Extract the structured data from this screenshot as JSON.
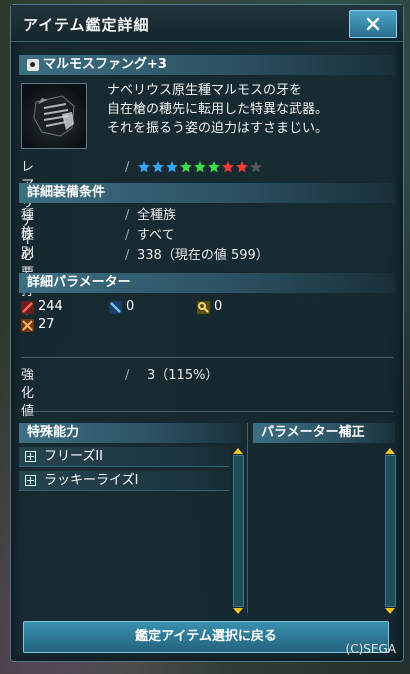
{
  "window": {
    "title": "アイテム鑑定詳細",
    "close_icon": "close-icon"
  },
  "item": {
    "name": "マルモスファング+3",
    "description": [
      "ナベリウス原生種マルモスの牙を",
      "自在槍の穂先に転用した特異な武器。",
      "それを振るう姿の迫力はすさまじい。"
    ]
  },
  "rarity": {
    "label": "レアリティ",
    "value": 8,
    "max": 9,
    "star_colors": [
      "#36a6ff",
      "#36a6ff",
      "#36a6ff",
      "#3ddc4a",
      "#3ddc4a",
      "#3ddc4a",
      "#ff3b3b",
      "#ff3b3b",
      "#555555"
    ]
  },
  "requirements": {
    "header": "詳細装備条件",
    "rows": [
      {
        "label": "種族",
        "value": "全種族"
      },
      {
        "label": "性別",
        "value": "すべて"
      },
      {
        "label": "必要打撃力",
        "value": "338（現在の値 599）"
      }
    ]
  },
  "parameters": {
    "header": "詳細パラメーター",
    "items": [
      {
        "icon": "striking-attack-icon",
        "value": "244",
        "color": "#d8463c"
      },
      {
        "icon": "ranged-attack-icon",
        "value": "0",
        "color": "#3e8fd6"
      },
      {
        "icon": "technique-attack-icon",
        "value": "0",
        "color": "#e0c040"
      },
      {
        "icon": "element-icon",
        "value": "27",
        "color": "#e38a3a"
      }
    ]
  },
  "grind": {
    "label": "強化値",
    "value": "3（115%）"
  },
  "special_abilities": {
    "header": "特殊能力",
    "items": [
      "フリーズII",
      "ラッキーライズI"
    ]
  },
  "param_correction": {
    "header": "パラメーター補正"
  },
  "buttons": {
    "return": "鑑定アイテム選択に戻る"
  },
  "copyright": "(C)SEGA",
  "colors": {
    "accent": "#3a8fb0",
    "panel": "#14282f",
    "scroll_arrow": "#f2c21a"
  }
}
